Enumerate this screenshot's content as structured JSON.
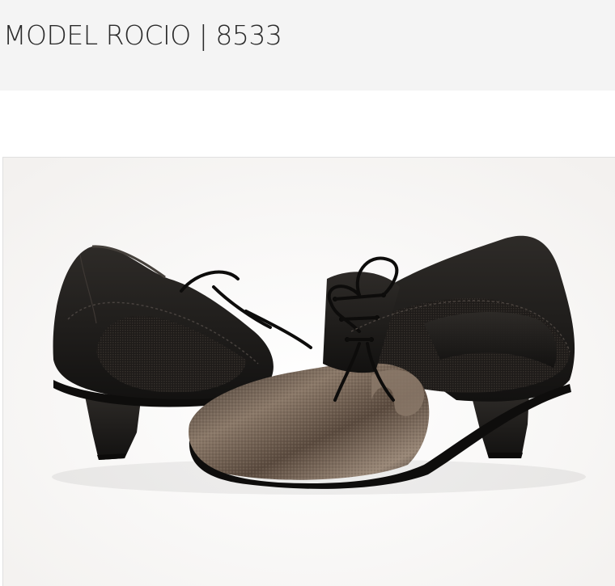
{
  "page": {
    "title": "MODEL ROCIO | 8533"
  },
  "product_image": {
    "subject": "pair of black and bronze lace-up dance shoes",
    "colors": {
      "leather": "#1c1a18",
      "mesh": "#2a2624",
      "metallic": "#6a5a4c",
      "background": "#ffffff"
    }
  }
}
